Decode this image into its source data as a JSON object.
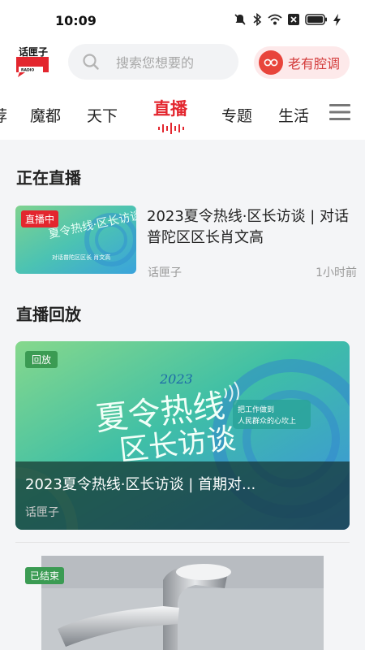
{
  "status_bar": {
    "time": "10:09"
  },
  "header": {
    "logo_text": "话匣子",
    "logo_subtext": "RADIO SHANGHAI",
    "search_placeholder": "搜索您想要的",
    "user_name": "老有腔调"
  },
  "tabs": [
    {
      "label": "荐"
    },
    {
      "label": "魔都"
    },
    {
      "label": "天下"
    },
    {
      "label": "直播",
      "active": true
    },
    {
      "label": "专题"
    },
    {
      "label": "生活"
    }
  ],
  "live_section": {
    "title": "正在直播",
    "item": {
      "badge": "直播中",
      "thumb_title": "夏令热线·区长访谈",
      "thumb_caption": "对话普陀区区长 肖文高",
      "title": "2023夏令热线·区长访谈 | 对话普陀区区长肖文高",
      "source": "话匣子",
      "time": "1小时前"
    }
  },
  "replay_section": {
    "title": "直播回放",
    "item": {
      "badge": "回放",
      "banner_year": "2023",
      "banner_line1": "夏令热线",
      "banner_line2": "区长访谈",
      "banner_slogan1": "把工作做到",
      "banner_slogan2": "人民群众的心坎上",
      "title": "2023夏令热线·区长访谈 | 首期对...",
      "source": "话匣子"
    }
  },
  "ended_item": {
    "badge": "已结束"
  },
  "colors": {
    "accent": "#e3262e",
    "badge_green": "#3b9b53"
  }
}
